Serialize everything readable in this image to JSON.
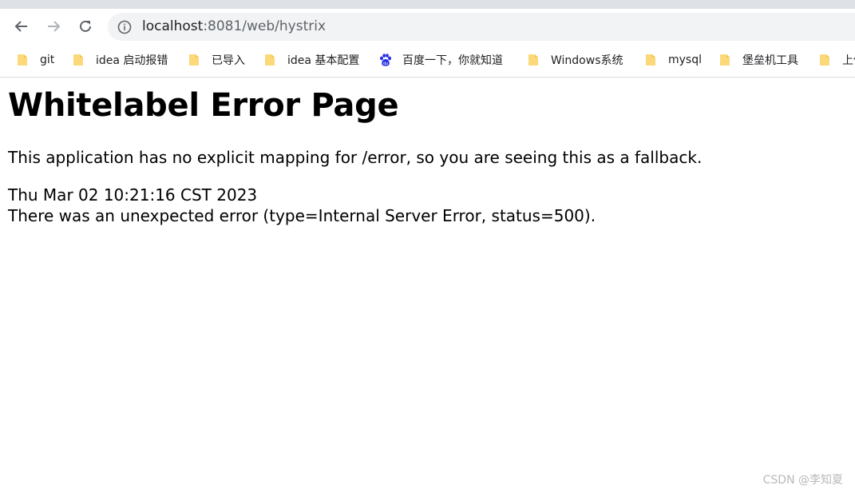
{
  "browser": {
    "back_icon": "arrow-left-icon",
    "forward_icon": "arrow-right-icon",
    "reload_icon": "reload-icon",
    "site_info_icon": "info-circle-icon",
    "url_host": "localhost",
    "url_rest": ":8081/web/hystrix"
  },
  "bookmarks": [
    {
      "label": "git",
      "icon": "folder-icon"
    },
    {
      "label": "idea 启动报错",
      "icon": "folder-icon"
    },
    {
      "label": "已导入",
      "icon": "folder-icon"
    },
    {
      "label": "idea 基本配置",
      "icon": "folder-icon"
    },
    {
      "label": "百度一下，你就知道",
      "icon": "baidu-paw-icon"
    },
    {
      "label": "Windows系统",
      "icon": "folder-icon"
    },
    {
      "label": "mysql",
      "icon": "folder-icon"
    },
    {
      "label": "堡垒机工具",
      "icon": "folder-icon"
    },
    {
      "label": "上传",
      "icon": "folder-icon"
    }
  ],
  "page": {
    "title": "Whitelabel Error Page",
    "message": "This application has no explicit mapping for /error, so you are seeing this as a fallback.",
    "timestamp": "Thu Mar 02 10:21:16 CST 2023",
    "error_line": "There was an unexpected error (type=Internal Server Error, status=500)."
  },
  "watermark": "CSDN @李知夏",
  "colors": {
    "folder": "#fbd97a",
    "baidu": "#2932e1",
    "tabstrip": "#dee1e6",
    "omnibox": "#f1f3f4"
  }
}
